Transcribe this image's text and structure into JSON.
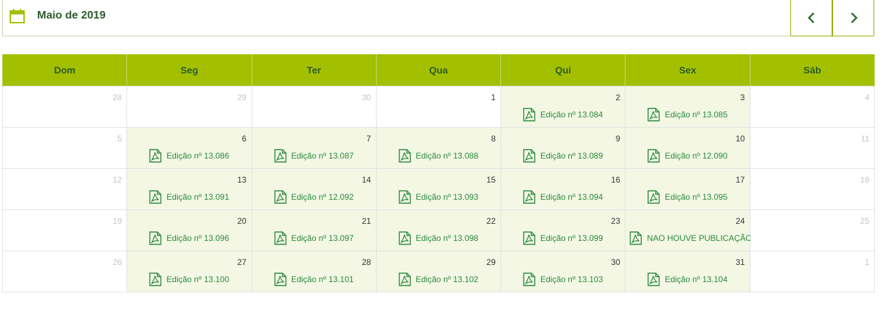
{
  "header": {
    "title": "Maio de 2019",
    "colors": {
      "brand": "#a3c000",
      "title": "#2d5b2a",
      "link": "#2a8a3c"
    },
    "icons": {
      "calendar": "calendar-icon",
      "prev": "chevron-left-icon",
      "next": "chevron-right-icon"
    }
  },
  "weekdays": [
    "Dom",
    "Seg",
    "Ter",
    "Qua",
    "Qui",
    "Sex",
    "Sáb"
  ],
  "weeks": [
    [
      {
        "day": "28",
        "muted": true,
        "edition": ""
      },
      {
        "day": "29",
        "muted": true,
        "edition": ""
      },
      {
        "day": "30",
        "muted": true,
        "edition": ""
      },
      {
        "day": "1",
        "muted": false,
        "edition": ""
      },
      {
        "day": "2",
        "muted": false,
        "edition": "Edição nº 13.084"
      },
      {
        "day": "3",
        "muted": false,
        "edition": "Edição nº 13.085"
      },
      {
        "day": "4",
        "muted": true,
        "edition": ""
      }
    ],
    [
      {
        "day": "5",
        "muted": true,
        "edition": ""
      },
      {
        "day": "6",
        "muted": false,
        "edition": "Edição nº 13.086"
      },
      {
        "day": "7",
        "muted": false,
        "edition": "Edição nº 13.087"
      },
      {
        "day": "8",
        "muted": false,
        "edition": "Edição nº 13.088"
      },
      {
        "day": "9",
        "muted": false,
        "edition": "Edição nº 13.089"
      },
      {
        "day": "10",
        "muted": false,
        "edition": "Edição nº 12.090"
      },
      {
        "day": "11",
        "muted": true,
        "edition": ""
      }
    ],
    [
      {
        "day": "12",
        "muted": true,
        "edition": ""
      },
      {
        "day": "13",
        "muted": false,
        "edition": "Edição nº 13.091"
      },
      {
        "day": "14",
        "muted": false,
        "edition": "Edição nº 12.092"
      },
      {
        "day": "15",
        "muted": false,
        "edition": "Edição nº 13.093"
      },
      {
        "day": "16",
        "muted": false,
        "edition": "Edição nº 13.094"
      },
      {
        "day": "17",
        "muted": false,
        "edition": "Edição nº 13.095"
      },
      {
        "day": "18",
        "muted": true,
        "edition": ""
      }
    ],
    [
      {
        "day": "19",
        "muted": true,
        "edition": ""
      },
      {
        "day": "20",
        "muted": false,
        "edition": "Edição nº 13.096"
      },
      {
        "day": "21",
        "muted": false,
        "edition": "Edição nº 13.097"
      },
      {
        "day": "22",
        "muted": false,
        "edition": "Edição nº 13.098"
      },
      {
        "day": "23",
        "muted": false,
        "edition": "Edição nº 13.099"
      },
      {
        "day": "24",
        "muted": false,
        "edition": "NAO HOUVE PUBLICAÇÃO"
      },
      {
        "day": "25",
        "muted": true,
        "edition": ""
      }
    ],
    [
      {
        "day": "26",
        "muted": true,
        "edition": ""
      },
      {
        "day": "27",
        "muted": false,
        "edition": "Edição nº 13.100"
      },
      {
        "day": "28",
        "muted": false,
        "edition": "Edição nº 13.101"
      },
      {
        "day": "29",
        "muted": false,
        "edition": "Edição nº 13.102"
      },
      {
        "day": "30",
        "muted": false,
        "edition": "Edição nº 13.103"
      },
      {
        "day": "31",
        "muted": false,
        "edition": "Edição nº 13.104"
      },
      {
        "day": "1",
        "muted": true,
        "edition": ""
      }
    ]
  ]
}
